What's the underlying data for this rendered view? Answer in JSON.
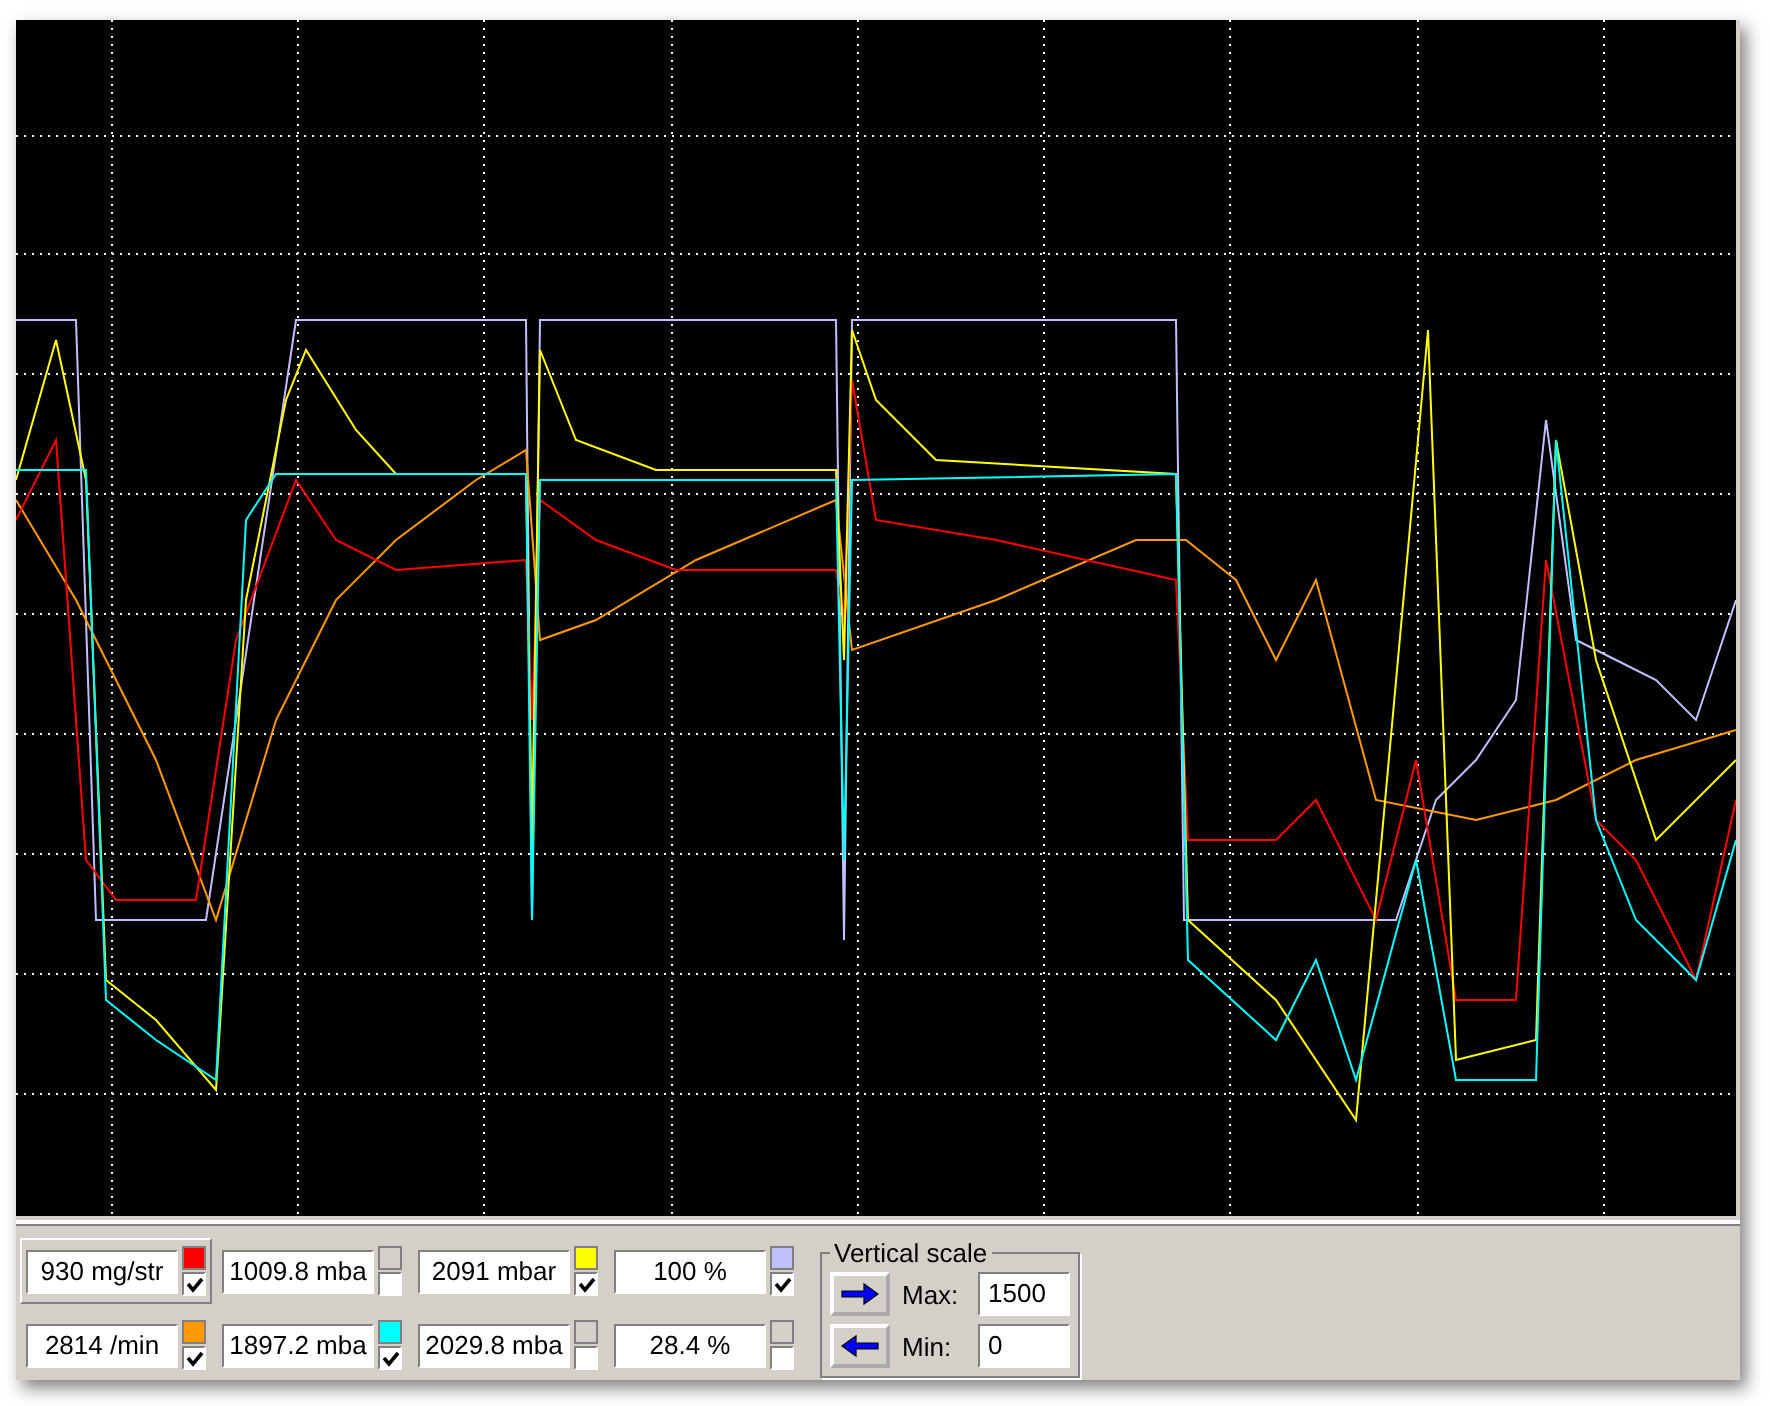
{
  "channels": [
    {
      "value": "930 mg/str",
      "color": "#ff0000",
      "checked": true,
      "selected": true
    },
    {
      "value": "1009.8 mba",
      "color": "#d4d0c8",
      "checked": false,
      "selected": false
    },
    {
      "value": "2091 mbar",
      "color": "#ffff00",
      "checked": true,
      "selected": false
    },
    {
      "value": "100 %",
      "color": "#c0c0ff",
      "checked": true,
      "selected": false
    },
    {
      "value": "2814 /min",
      "color": "#ff9900",
      "checked": true,
      "selected": false
    },
    {
      "value": "1897.2 mba",
      "color": "#00ffff",
      "checked": true,
      "selected": false
    },
    {
      "value": "2029.8 mba",
      "color": "#d4d0c8",
      "checked": false,
      "selected": false
    },
    {
      "value": "28.4 %",
      "color": "#d4d0c8",
      "checked": false,
      "selected": false
    }
  ],
  "vertical_scale": {
    "title": "Vertical scale",
    "max_label": "Max:",
    "max_value": "1500",
    "min_label": "Min:",
    "min_value": "0"
  }
}
